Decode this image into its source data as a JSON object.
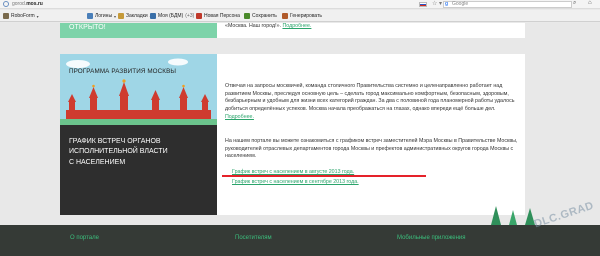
{
  "browser": {
    "url_prefix": "gorod.",
    "url_domain": "mos.ru",
    "search_placeholder": "Google"
  },
  "bookmarks": [
    {
      "label": "RoboForm",
      "icon": "roboform-icon",
      "color": "#7a6a4d",
      "dropdown": true
    },
    {
      "label": "Логины",
      "icon": "logins-icon",
      "color": "#4a7fb9",
      "dropdown": true
    },
    {
      "label": "Закладки",
      "icon": "bookmarks-icon",
      "color": "#c59a3a",
      "dropdown": true
    },
    {
      "label": "Моя (БДМ)",
      "icon": "mail-icon",
      "color": "#3a6fa8",
      "dropdown": false,
      "count": "(+3)"
    },
    {
      "label": "Новая Персона",
      "icon": "persona-icon",
      "color": "#c0392b",
      "dropdown": false
    },
    {
      "label": "Сохранить",
      "icon": "save-icon",
      "color": "#4a8a2a",
      "dropdown": false
    },
    {
      "label": "Генерировать",
      "icon": "generate-icon",
      "color": "#b05a2a",
      "dropdown": false
    }
  ],
  "cards": {
    "open": {
      "title": "ОТКРЫТО!",
      "text": "«Москва. Наш город!».",
      "link": "Подробнее."
    },
    "program": {
      "title": "ПРОГРАММА РАЗВИТИЯ МОСКВЫ",
      "text": "Отвечая на запросы москвичей, команда столичного Правительства системно и целенаправленно работает над развитием Москвы, преследуя основную цель – сделать город максимально комфортным, безопасным, здоровым, безбарьерным и удобным для жизни всех категорий граждан. За два с половиной года планомерной работы удалось добиться определённых успехов. Москва начала преображаться на глазах, однако впереди ещё больше дел.",
      "link": "Подробнее."
    },
    "schedule": {
      "title": "ГРАФИК ВСТРЕЧ ОРГАНОВ\nИСПОЛНИТЕЛЬНОЙ ВЛАСТИ\nС НАСЕЛЕНИЕМ",
      "text": "На нашем портале вы можете ознакомиться с графиком встреч заместителей Мэра Москвы в Правительстве Москвы, руководителей отраслевых департаментов города Москвы и префектов административных округов города Москвы с населением.",
      "link_aug": "График встреч с населением в августе 2013 года.",
      "link_sep": "График встреч с населением в сентябре 2013 года."
    }
  },
  "footer": {
    "col1": "О портале",
    "col2": "Посетителям",
    "col3": "Мобильные приложения"
  },
  "watermark": "DLC.GRAD",
  "colors": {
    "accent": "#2aa46b",
    "highlight": "#e5222a",
    "footer_bg": "#353a36"
  }
}
